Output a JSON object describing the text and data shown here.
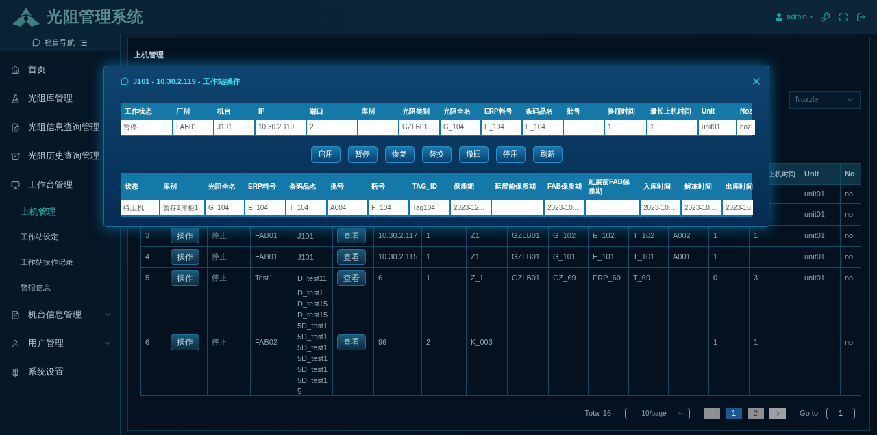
{
  "app": {
    "title": "光阻管理系统"
  },
  "header": {
    "user": "admin",
    "caret": "▾"
  },
  "sidebar": {
    "heading": "栏目导航",
    "items": [
      {
        "label": "首页",
        "selected": false
      },
      {
        "label": "光阻库管理",
        "selected": false
      },
      {
        "label": "光阻信息查询管理",
        "selected": false
      },
      {
        "label": "光阻历史查询管理",
        "selected": false
      },
      {
        "label": "工作台管理",
        "selected": false,
        "expanded": true,
        "children": [
          {
            "label": "上机管理",
            "selected": true
          },
          {
            "label": "工作站设定",
            "selected": false
          },
          {
            "label": "工作站操作记录",
            "selected": false
          },
          {
            "label": "警报信息",
            "selected": false
          }
        ]
      },
      {
        "label": "机台信息管理",
        "selected": false,
        "expanded": false
      },
      {
        "label": "用户管理",
        "selected": false,
        "expanded": false
      },
      {
        "label": "系统设置",
        "selected": false
      }
    ]
  },
  "tabs": [
    {
      "label": "上机管理",
      "selected": true
    }
  ],
  "filter": {
    "placeholder": "Nozzle"
  },
  "table": {
    "columns": [
      "上机时间",
      "Unit",
      "No"
    ],
    "rows": [
      [
        {},
        "unit01",
        "no"
      ],
      [
        {},
        "unit01",
        "no"
      ],
      [
        "3",
        "操作",
        "停止",
        "FAB01",
        "J101",
        "查看",
        "10.30.2.117",
        "1",
        "Z1",
        "GZLB01",
        "G_102",
        "E_102",
        "T_102",
        "A002",
        "1",
        "1",
        "unit01",
        "no"
      ],
      [
        "4",
        "操作",
        "停止",
        "FAB01",
        "J101",
        "查看",
        "10.30.2.115",
        "1",
        "Z1",
        "GZLB01",
        "G_101",
        "E_101",
        "T_101",
        "A001",
        "1",
        {},
        "unit01",
        "no"
      ],
      [
        "5",
        "操作",
        "停止",
        "Test1",
        "D_test11",
        "查看",
        "6",
        "1",
        "Z_1",
        "GZLB01",
        "GZ_69",
        "ERP_69",
        "T_69",
        {},
        "0",
        "3",
        "unit01",
        "no"
      ],
      [
        "6",
        "操作",
        "停止",
        "FAB02",
        "D_test1D_test15D_test155D_test15D_test15D_test15D_test15D_test15D_test15",
        "查看",
        "96",
        "2",
        "K_003",
        {},
        {},
        {},
        {},
        {},
        "1",
        "1",
        {},
        "no"
      ]
    ]
  },
  "pagination": {
    "total": "Total 16",
    "page_size": "10/page",
    "prev_disabled": true,
    "next_disabled": false,
    "pages": [
      {
        "label": "1",
        "selected": true
      },
      {
        "label": "2",
        "selected": false
      }
    ],
    "goto_label": "Go to",
    "goto_value": "1"
  },
  "modal": {
    "title": "J101 - 10.30.2.119 - 工作站操作",
    "status_table": {
      "columns": [
        {
          "label": "工作状态",
          "value": "暂停"
        },
        {
          "label": "厂别",
          "value": "FAB01"
        },
        {
          "label": "机台",
          "value": "J101"
        },
        {
          "label": "IP",
          "value": "10.30.2.119"
        },
        {
          "label": "端口",
          "value": "2"
        },
        {
          "label": "库别"
        },
        {
          "label": "光阻类别",
          "value": "GZLB01"
        },
        {
          "label": "光阻全名",
          "value": "G_104"
        },
        {
          "label": "ERP料号",
          "value": "E_104"
        },
        {
          "label": "条码品名",
          "value": "E_104"
        },
        {
          "label": "批号"
        },
        {
          "label": "换瓶时间",
          "value": "1"
        },
        {
          "label": "最长上机时间",
          "value": "1"
        },
        {
          "label": "Unit",
          "value": "unit01"
        },
        {
          "label": "Noz",
          "value": "noz"
        }
      ]
    },
    "buttons": [
      "启用",
      "暂停",
      "恢复",
      "替换",
      "撤回",
      "停用",
      "刷新"
    ],
    "item_table": {
      "columns": [
        {
          "label": "状态",
          "value": "待上机"
        },
        {
          "label": "库别",
          "value": "暂存1库柜1"
        },
        {
          "label": "光阻全名",
          "value": "G_104"
        },
        {
          "label": "ERP料号",
          "value": "E_104"
        },
        {
          "label": "条码品名",
          "value": "T_104"
        },
        {
          "label": "批号",
          "value": "A004"
        },
        {
          "label": "瓶号",
          "value": "P_104"
        },
        {
          "label": "TAG_ID",
          "value": "Tag104"
        },
        {
          "label": "保质期",
          "value": "2023-12..."
        },
        {
          "label": "延展前保质期"
        },
        {
          "label": "FAB保质期",
          "value": "2023-10..."
        },
        {
          "label": "延展前FAB保质期"
        },
        {
          "label": "入库时间",
          "value": "2023-10..."
        },
        {
          "label": "解冻时间",
          "value": "2023-10..."
        },
        {
          "label": "出库时间",
          "value": "2023-10."
        }
      ]
    }
  }
}
